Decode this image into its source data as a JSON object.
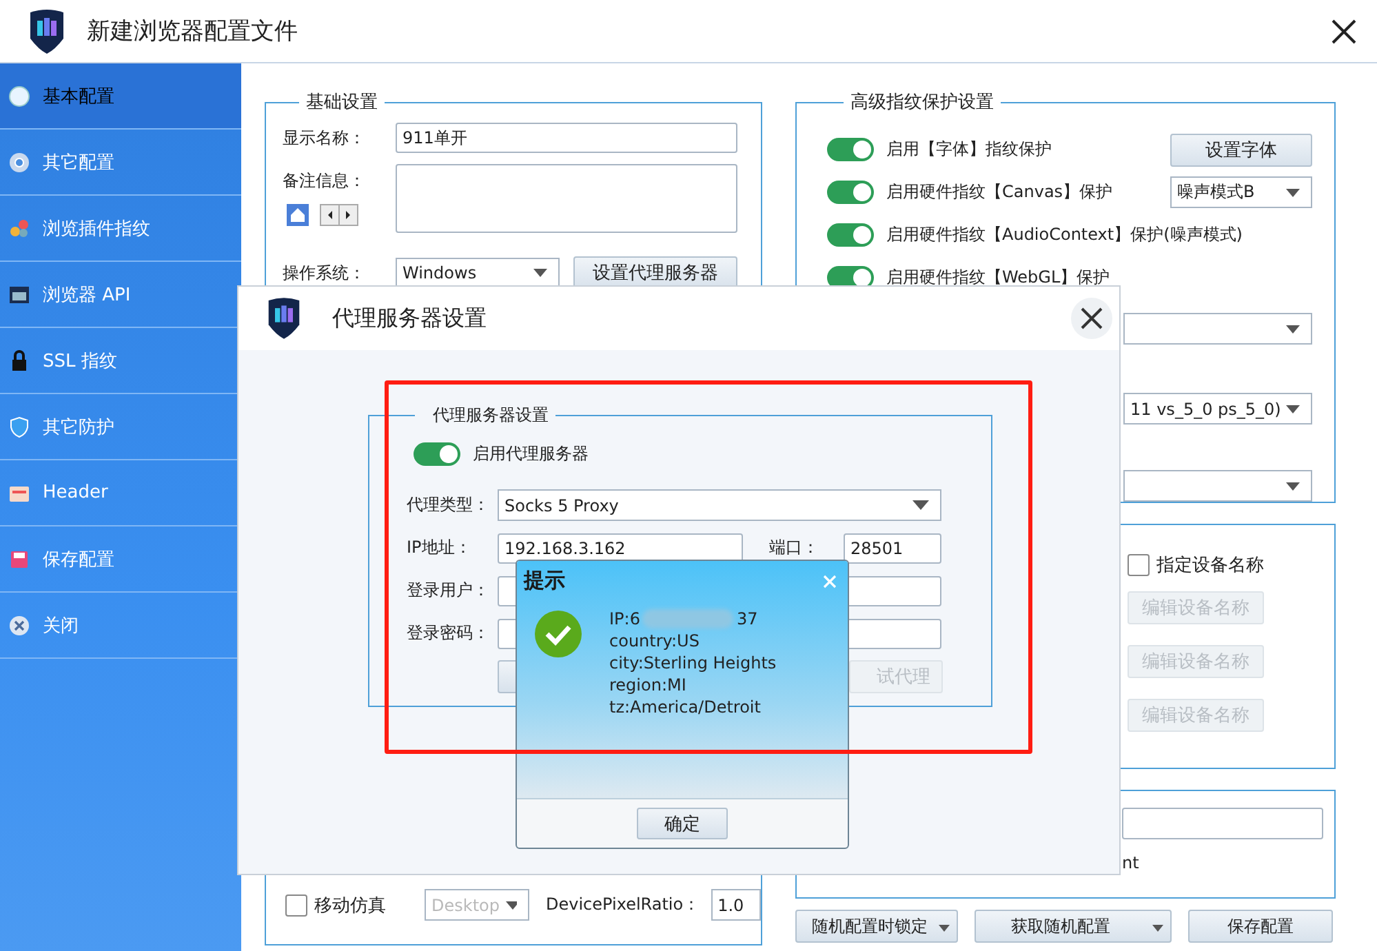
{
  "window": {
    "title": "新建浏览器配置文件"
  },
  "sidebar": {
    "items": [
      {
        "label": "基本配置",
        "selected": true
      },
      {
        "label": "其它配置",
        "selected": false
      },
      {
        "label": "浏览插件指纹",
        "selected": false
      },
      {
        "label": "浏览器 API",
        "selected": false
      },
      {
        "label": "SSL 指纹",
        "selected": false
      },
      {
        "label": "其它防护",
        "selected": false
      },
      {
        "label": "Header",
        "selected": false
      },
      {
        "label": "保存配置",
        "selected": false
      },
      {
        "label": "关闭",
        "selected": false
      }
    ]
  },
  "basic_settings": {
    "title": "基础设置",
    "display_name": {
      "label": "显示名称：",
      "value": "911单开"
    },
    "notes": {
      "label": "备注信息："
    },
    "os": {
      "label": "操作系统：",
      "value": "Windows"
    },
    "proxy_button": "设置代理服务器"
  },
  "emulation": {
    "mobile": {
      "label": "移动仿真",
      "checked": false
    },
    "device": {
      "value": "Desktop",
      "disabled": true
    },
    "dpr": {
      "label": "DevicePixelRatio：",
      "value": "1.0"
    }
  },
  "advanced": {
    "title": "高级指纹保护设置",
    "toggles": [
      {
        "label": "启用【字体】指纹保护",
        "on": true
      },
      {
        "label": "启用硬件指纹【Canvas】保护",
        "on": true
      },
      {
        "label": "启用硬件指纹【AudioContext】保护(噪声模式)",
        "on": true
      },
      {
        "label": "启用硬件指纹【WebGL】保护",
        "on": true
      }
    ],
    "font_button": "设置字体",
    "canvas_mode": "噪声模式B",
    "webgl_version": "11 vs_5_0 ps_5_0)"
  },
  "device_name": {
    "checkbox": {
      "label": "指定设备名称",
      "checked": false
    },
    "buttons": [
      {
        "label": "编辑设备名称",
        "disabled": true
      },
      {
        "label": "编辑设备名称",
        "disabled": true
      },
      {
        "label": "编辑设备名称",
        "disabled": true
      }
    ]
  },
  "user_agent": {
    "text_fragment": "nt"
  },
  "footer_buttons": [
    {
      "label": "随机配置时锁定",
      "dropdown": true
    },
    {
      "label": "获取随机配置",
      "dropdown": true
    },
    {
      "label": "保存配置",
      "dropdown": false
    }
  ],
  "proxy_dialog": {
    "title": "代理服务器设置",
    "group_title": "代理服务器设置",
    "enable": {
      "label": "启用代理服务器",
      "on": true
    },
    "type": {
      "label": "代理类型：",
      "value": "Socks 5 Proxy"
    },
    "ip": {
      "label": "IP地址：",
      "value": "192.168.3.162"
    },
    "port": {
      "label": "端口：",
      "value": "28501"
    },
    "user": {
      "label": "登录用户："
    },
    "password": {
      "label": "登录密码："
    },
    "test_button": "试代理"
  },
  "alert": {
    "title": "提示",
    "ip_prefix": "IP:6",
    "ip_suffix": "37",
    "lines": [
      "country:US",
      "city:Sterling Heights",
      "region:MI",
      "tz:America/Detroit"
    ],
    "ok_button": "确定"
  }
}
